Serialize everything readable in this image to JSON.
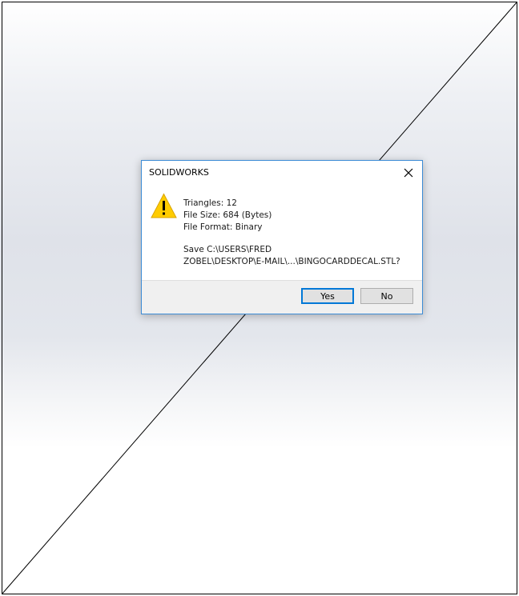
{
  "dialog": {
    "title": "SOLIDWORKS",
    "lines": [
      "Triangles: 12",
      "File Size: 684 (Bytes)",
      "File Format: Binary"
    ],
    "save_line1": "Save C:\\USERS\\FRED",
    "save_line2": "ZOBEL\\DESKTOP\\E-MAIL\\...\\BINGOCARDDECAL.STL?",
    "yes_label": "Yes",
    "no_label": "No",
    "icon": "warning-icon",
    "close_icon": "close-icon"
  },
  "colors": {
    "dialog_border": "#3c8cd6",
    "default_button_border": "#0078d7",
    "warning_fill": "#ffcc00"
  }
}
